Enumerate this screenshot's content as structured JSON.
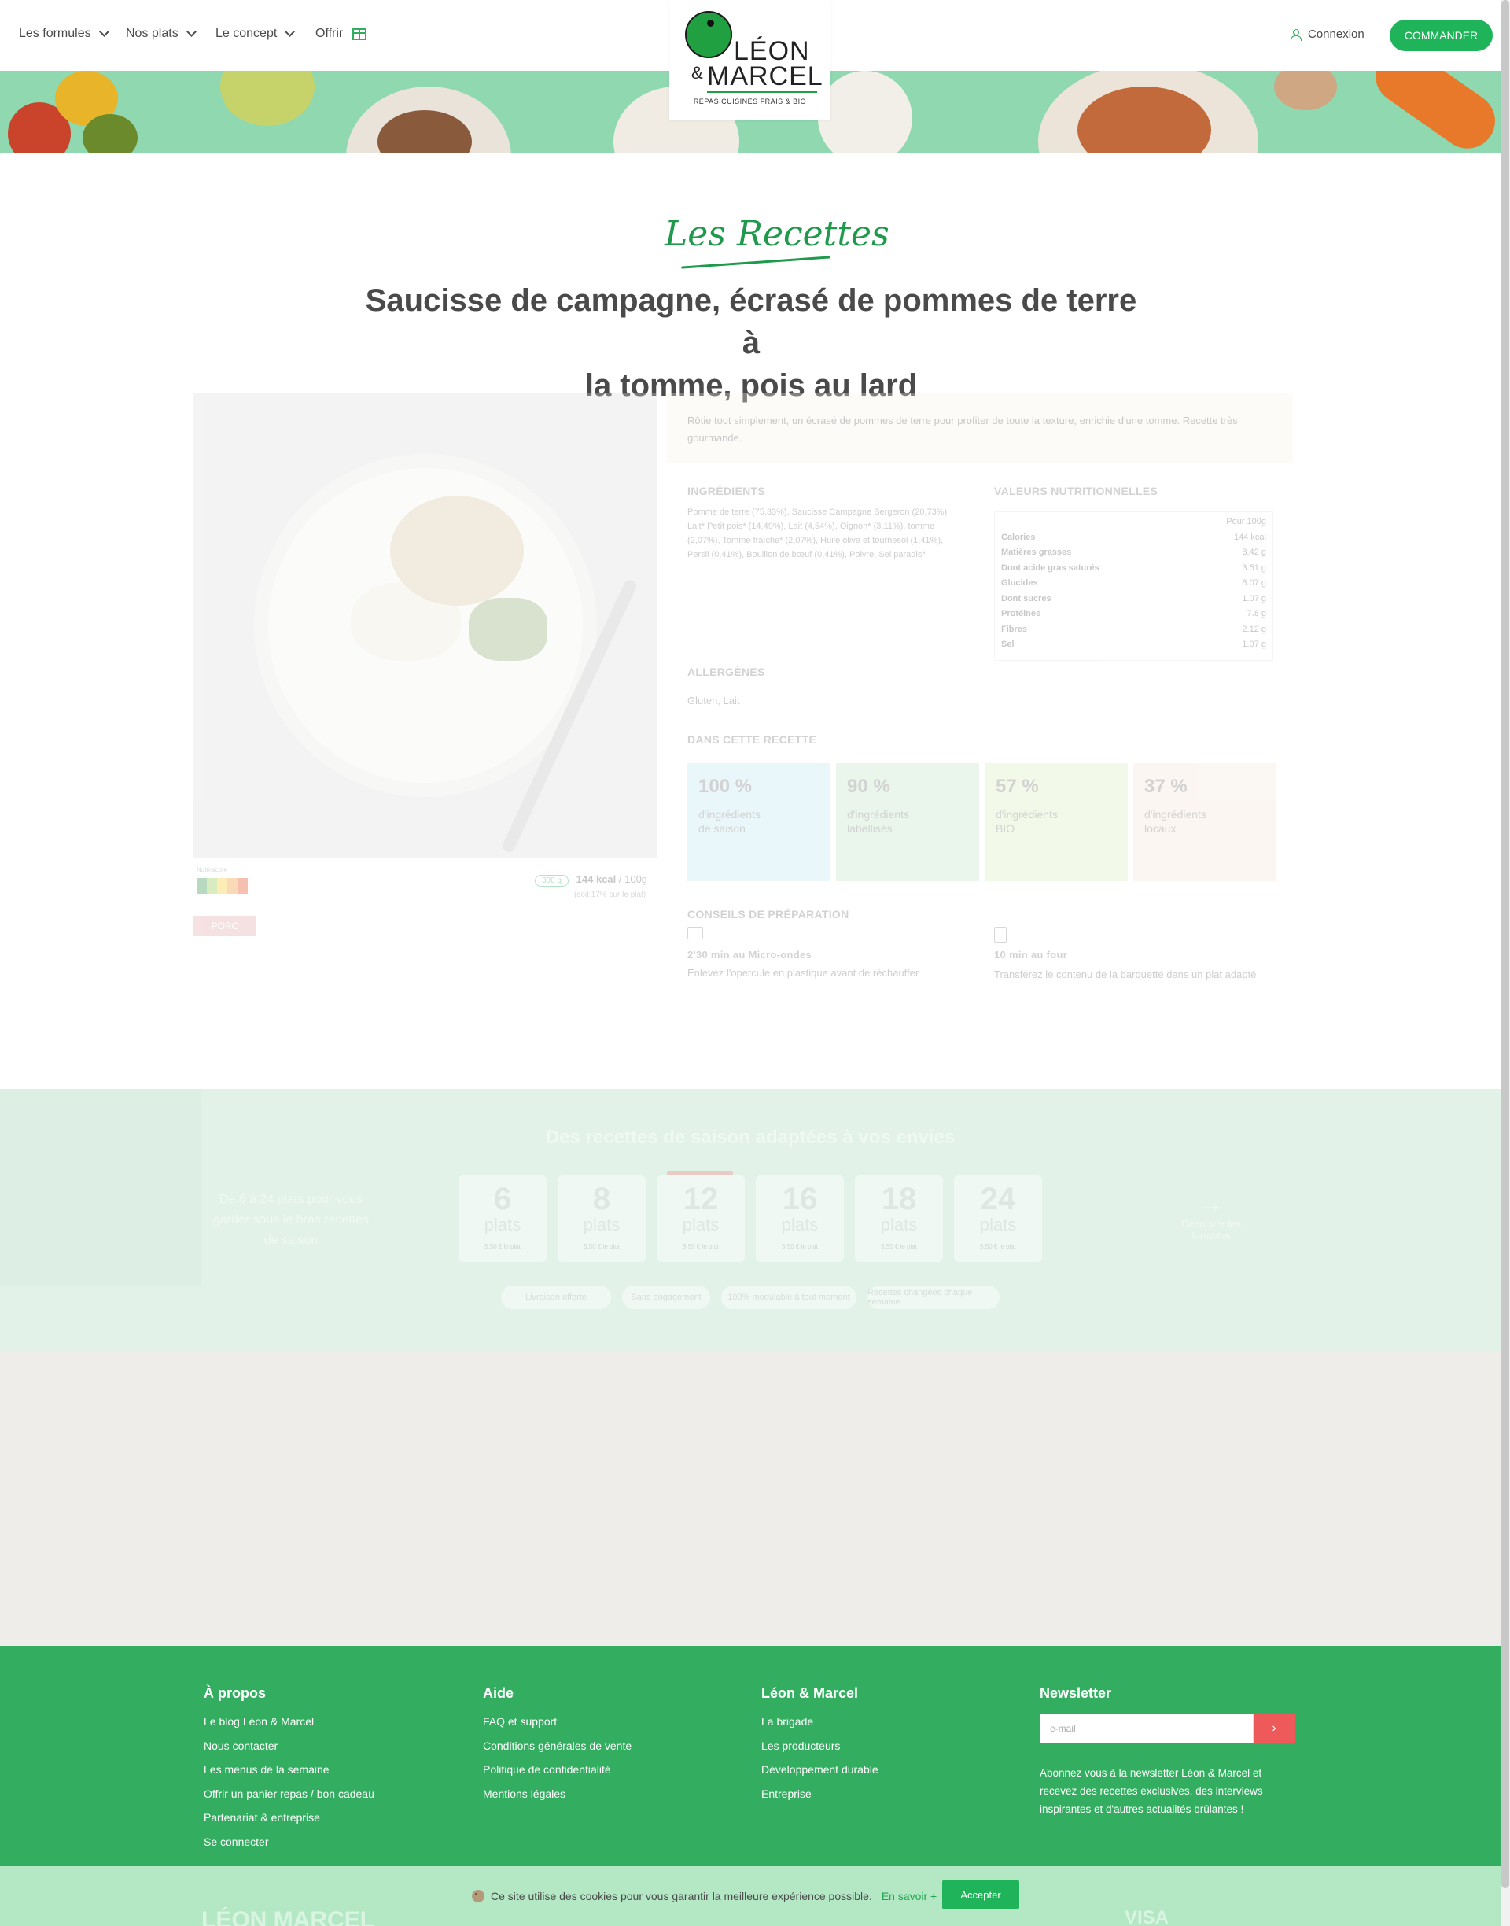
{
  "header": {
    "nav": [
      {
        "label": "Les formules",
        "icon": "chevron-down-icon"
      },
      {
        "label": "Nos plats",
        "icon": "chevron-down-icon"
      },
      {
        "label": "Le concept",
        "icon": "chevron-down-icon"
      },
      {
        "label": "Offrir",
        "icon": "gift-icon"
      }
    ],
    "logo": {
      "line1": "LÉON",
      "amp": "&",
      "line2": "MARCEL",
      "tagline": "REPAS CUISINÉS FRAIS & BIO"
    },
    "login_label": "Connexion",
    "order_label": "COMMANDER",
    "colors": {
      "accent": "#20b45a",
      "banner": "#8fd8b0"
    }
  },
  "recipe": {
    "section_script": "Les Recettes",
    "title_line1": "Saucisse de campagne, écrasé de pommes de terre à",
    "title_line2": "la tomme, pois au lard",
    "nutriscore_label": "Nutri-score",
    "nutriscore_letters": [
      "A",
      "B",
      "C",
      "D",
      "E"
    ],
    "weight_pill": "300 g",
    "kcal": "144 kcal",
    "kcal_per": "/ 100g",
    "kcal_sub": "(soit 17% sur le plat)",
    "tag": "PORC",
    "description": "Rôtie tout simplement, un écrasé de pommes de terre pour profiter de toute la texture, enrichie d'une tomme. Recette très gourmande.",
    "ingredients_title": "INGRÉDIENTS",
    "ingredients_text": "Pomme de terre (75,33%), Saucisse Campagne Bergeron (20,73%) Lait* Petit pois* (14,49%), Lait (4,54%), Oignon* (3,11%), tomme (2,07%), Tomme fraîche* (2,07%), Huile olive et tournesol (1,41%), Persil (0,41%), Bouillon de bœuf (0,41%), Poivre, Sel paradis*",
    "nutrition_title": "VALEURS NUTRITIONNELLES",
    "nutrition_header": "Pour 100g",
    "nutrition_rows": [
      {
        "k": "Calories",
        "v": "144 kcal"
      },
      {
        "k": "Matières grasses",
        "v": "8.42 g"
      },
      {
        "k": "Dont acide gras saturés",
        "v": "3.51 g"
      },
      {
        "k": "Glucides",
        "v": "8.07 g"
      },
      {
        "k": "Dont sucres",
        "v": "1.07 g"
      },
      {
        "k": "Protéines",
        "v": "7.8 g"
      },
      {
        "k": "Fibres",
        "v": "2.12 g"
      },
      {
        "k": "Sel",
        "v": "1.07 g"
      }
    ],
    "allergens_title": "ALLERGÈNES",
    "allergens_text": "Gluten, Lait",
    "in_recipe_title": "DANS CETTE RECETTE",
    "cards": [
      {
        "pct": "100 %",
        "l1": "d'ingrédients",
        "l2": "de saison",
        "color": "#bfe8f0"
      },
      {
        "pct": "90 %",
        "l1": "d'ingrédients",
        "l2": "labellisés",
        "color": "#bfe6c5"
      },
      {
        "pct": "57 %",
        "l1": "d'ingrédients",
        "l2": "BIO",
        "color": "#d9eebb"
      },
      {
        "pct": "37 %",
        "l1": "d'ingrédients",
        "l2": "locaux",
        "color": "#f3e6d6"
      }
    ],
    "prep_title": "CONSEILS DE PRÉPARATION",
    "prep": [
      {
        "icon": "microwave-icon",
        "title": "2'30 min au Micro-ondes",
        "text": "Enlevez l'opercule en plastique avant de réchauffer"
      },
      {
        "icon": "oven-icon",
        "title": "10 min au four",
        "text": "Transférez le contenu de la barquette dans un plat adapté"
      }
    ]
  },
  "plans": {
    "title": "Des recettes de saison adaptées à vos envies",
    "left_text": "De 6 à 24 plats pour vous garder sous le bras recettes de saison",
    "right_text": "Découvrir les formules",
    "unit": "plats",
    "items": [
      {
        "n": "6",
        "price": "5,50 € le plat"
      },
      {
        "n": "8",
        "price": "5,50 € le plat"
      },
      {
        "n": "12",
        "price": "5,50 € le plat"
      },
      {
        "n": "16",
        "price": "5,50 € le plat"
      },
      {
        "n": "18",
        "price": "5,50 € le plat"
      },
      {
        "n": "24",
        "price": "5,50 € le plat"
      }
    ],
    "chips": [
      "Livraison offerte",
      "Sans engagement",
      "100% modulable à tout moment",
      "Recettes changées chaque semaine"
    ]
  },
  "footer": {
    "cols": [
      {
        "title": "À propos",
        "links": [
          "Le blog Léon & Marcel",
          "Nous contacter",
          "Les menus de la semaine",
          "Offrir un panier repas / bon cadeau",
          "Partenariat & entreprise",
          "Se connecter"
        ]
      },
      {
        "title": "Aide",
        "links": [
          "FAQ et support",
          "Conditions générales de vente",
          "Politique de confidentialité",
          "Mentions légales"
        ]
      },
      {
        "title": "Léon & Marcel",
        "links": [
          "La brigade",
          "Les producteurs",
          "Développement durable",
          "Entreprise"
        ]
      }
    ],
    "newsletter": {
      "title": "Newsletter",
      "placeholder": "e-mail",
      "text": "Abonnez vous à la newsletter Léon & Marcel et recevez des recettes exclusives, des interviews inspirantes et d'autres actualités brûlantes !",
      "btn": "›"
    }
  },
  "cookie": {
    "text": "Ce site utilise des cookies pour vous garantir la meilleure expérience possible.",
    "link": "En savoir +",
    "accept": "Accepter",
    "under_logo": "LÉON MARCEL",
    "under_visa": "VISA"
  }
}
